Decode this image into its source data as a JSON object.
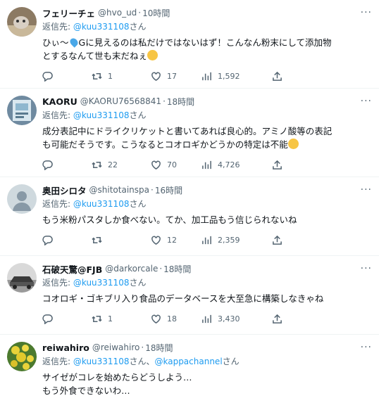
{
  "tweets": [
    {
      "name": "フェリーチェ",
      "handle": "@hvo_ud",
      "time": "10時間",
      "reply_prefix": "返信先: ",
      "reply_to": "@kuu331108",
      "reply_suffix": "さん",
      "text1": "ひぃ〜",
      "text2": "Gに見えるのは私だけではないはず！こんなん粉末にして添加物",
      "text3": "とするなんて世も末だねぇ",
      "replies": "",
      "retweets": "1",
      "likes": "17",
      "views": "1,592",
      "avatar_icon": "avatar-photo-cat"
    },
    {
      "name": "KAORU",
      "handle": "@KAORU76568841",
      "time": "18時間",
      "reply_prefix": "返信先: ",
      "reply_to": "@kuu331108",
      "reply_suffix": "さん",
      "text": "成分表記中にドライクリケットと書いてあれば良心的。アミノ酸等の表記\nも可能だそうです。こうなるとコオロギかどうかの特定は不能",
      "replies": "",
      "retweets": "22",
      "likes": "70",
      "views": "4,726",
      "avatar_icon": "avatar-photo-poster"
    },
    {
      "name": "奥田シロタ",
      "handle": "@shitotainspa",
      "time": "16時間",
      "reply_prefix": "返信先: ",
      "reply_to": "@kuu331108",
      "reply_suffix": "さん",
      "text": "もう米粉パスタしか食べない。てか、加工品もう信じられないね",
      "replies": "",
      "retweets": "",
      "likes": "12",
      "views": "2,359",
      "avatar_icon": "default-avatar-icon"
    },
    {
      "name": "石破天驚@FJB",
      "handle": "@darkorcale",
      "time": "18時間",
      "reply_prefix": "返信先: ",
      "reply_to": "@kuu331108",
      "reply_suffix": "さん",
      "text": "コオロギ・ゴキブリ入り食品のデータベースを大至急に構築しなきゃね",
      "replies": "",
      "retweets": "1",
      "likes": "18",
      "views": "3,430",
      "avatar_icon": "avatar-photo-car"
    },
    {
      "name": "reiwahiro",
      "handle": "@reiwahiro",
      "time": "18時間",
      "reply_prefix": "返信先: ",
      "reply_to": "@kuu331108",
      "reply_mid": "さん、",
      "reply_to2": "@kappachannel",
      "reply_suffix": "さん",
      "text": "サイゼがコレを始めたらどうしよう…\nもう外食できないわ…",
      "avatar_icon": "avatar-photo-flowers"
    }
  ],
  "colors": {
    "link": "#1d9bf0",
    "secondary": "#536471",
    "divider": "#eff3f4"
  }
}
